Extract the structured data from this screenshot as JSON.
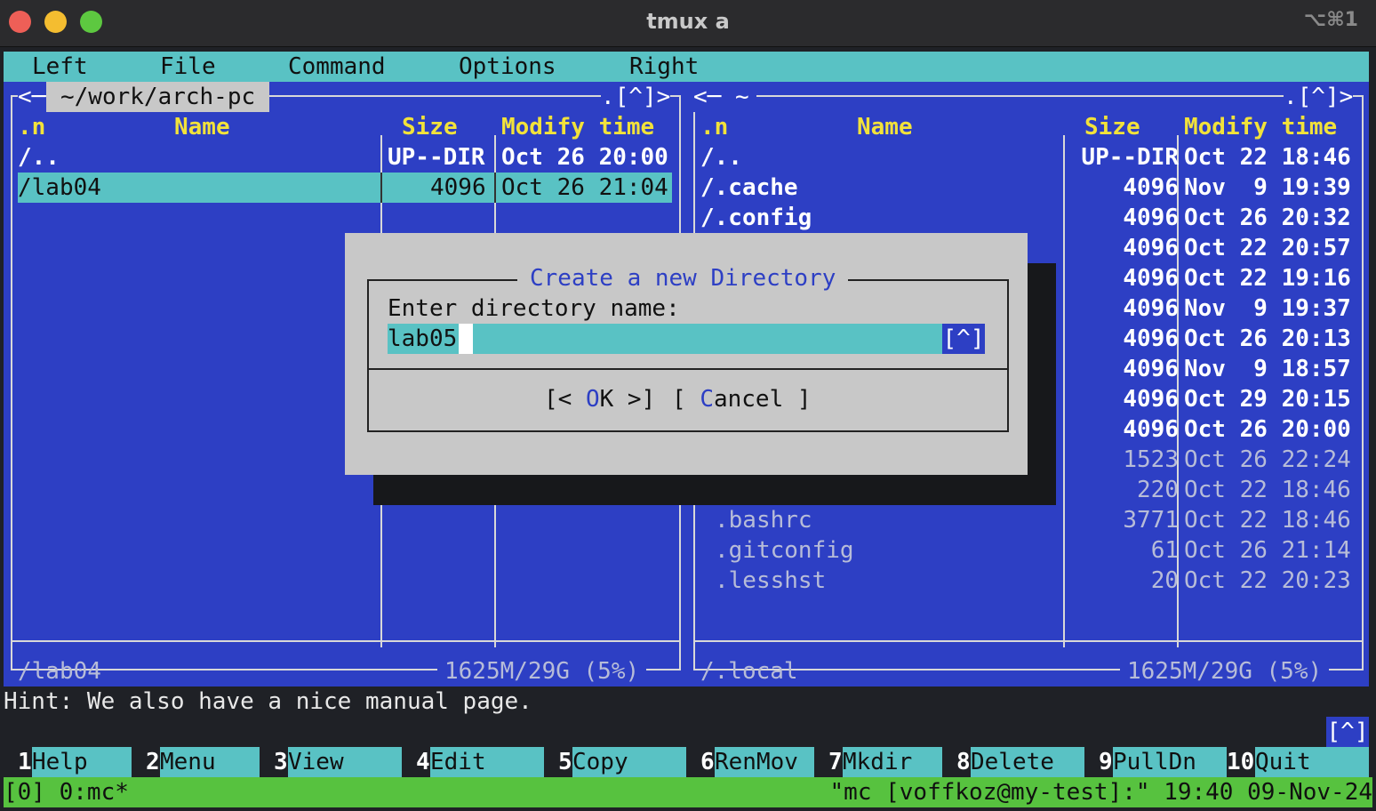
{
  "window": {
    "title": "tmux a",
    "shortcut": "⌥⌘1"
  },
  "menubar": {
    "items": [
      "Left",
      "File",
      "Command",
      "Options",
      "Right"
    ]
  },
  "left_panel": {
    "corner_left": "<─",
    "path": "~/work/arch-pc",
    "corner_right": ".[^]>",
    "headers": {
      "sort": ".n",
      "name": "Name",
      "size": "Size",
      "mtime": "Modify time"
    },
    "rows": [
      {
        "name": "/..",
        "size": "UP--DIR",
        "mtime": "Oct 26 20:00"
      },
      {
        "name": "/lab04",
        "size": "4096",
        "mtime": "Oct 26 21:04"
      }
    ],
    "mini_status": "/lab04",
    "disk": "1625M/29G (5%)"
  },
  "right_panel": {
    "corner_left": "<─ ~",
    "corner_right": ".[^]>",
    "headers": {
      "sort": ".n",
      "name": "Name",
      "size": "Size",
      "mtime": "Modify time"
    },
    "rows": [
      {
        "name": "/..",
        "size": "UP--DIR",
        "mtime": "Oct 22 18:46"
      },
      {
        "name": "/.cache",
        "size": "4096",
        "mtime": "Nov  9 19:39"
      },
      {
        "name": "/.config",
        "size": "4096",
        "mtime": "Oct 26 20:32"
      },
      {
        "name": "",
        "size": "4096",
        "mtime": "Oct 22 20:57"
      },
      {
        "name": "",
        "size": "4096",
        "mtime": "Oct 22 19:16"
      },
      {
        "name": "",
        "size": "4096",
        "mtime": "Nov  9 19:37"
      },
      {
        "name": "",
        "size": "4096",
        "mtime": "Oct 26 20:13"
      },
      {
        "name": "",
        "size": "4096",
        "mtime": "Nov  9 18:57"
      },
      {
        "name": "",
        "size": "4096",
        "mtime": "Oct 29 20:15"
      },
      {
        "name": "",
        "size": "4096",
        "mtime": "Oct 26 20:00"
      },
      {
        "name": "",
        "size": "1523",
        "mtime": "Oct 26 22:24"
      },
      {
        "name": ".bash_logout",
        "size": "220",
        "mtime": "Oct 22 18:46"
      },
      {
        "name": ".bashrc",
        "size": "3771",
        "mtime": "Oct 22 18:46"
      },
      {
        "name": ".gitconfig",
        "size": "61",
        "mtime": "Oct 26 21:14"
      },
      {
        "name": ".lesshst",
        "size": "20",
        "mtime": "Oct 22 20:23"
      }
    ],
    "mini_status": "/.local",
    "disk": "1625M/29G (5%)"
  },
  "dialog": {
    "title": "Create a new Directory",
    "prompt": "Enter directory name:",
    "input_value": "lab05",
    "history_button": "[^]",
    "ok_open": "[< ",
    "ok_hot": "O",
    "ok_rest": "K >]",
    "cancel_open": "[ ",
    "cancel_hot": "C",
    "cancel_rest": "ancel ]"
  },
  "hint": "Hint: We also have a nice manual page.",
  "cmd_history_button": "[^]",
  "function_keys": [
    {
      "num": "1",
      "label": "Help"
    },
    {
      "num": "2",
      "label": "Menu"
    },
    {
      "num": "3",
      "label": "View"
    },
    {
      "num": "4",
      "label": "Edit"
    },
    {
      "num": "5",
      "label": "Copy"
    },
    {
      "num": "6",
      "label": "RenMov"
    },
    {
      "num": "7",
      "label": "Mkdir"
    },
    {
      "num": "8",
      "label": "Delete"
    },
    {
      "num": "9",
      "label": "PullDn"
    },
    {
      "num": "10",
      "label": "Quit"
    }
  ],
  "tmux_status": {
    "left": "[0] 0:mc*",
    "right": "\"mc [voffkoz@my-test]:\" 19:40 09-Nov-24"
  },
  "colors": {
    "panel_bg": "#2d3fc4",
    "accent_cyan": "#59c2c4",
    "header_yellow": "#f2e23a",
    "status_green": "#57c23f"
  }
}
